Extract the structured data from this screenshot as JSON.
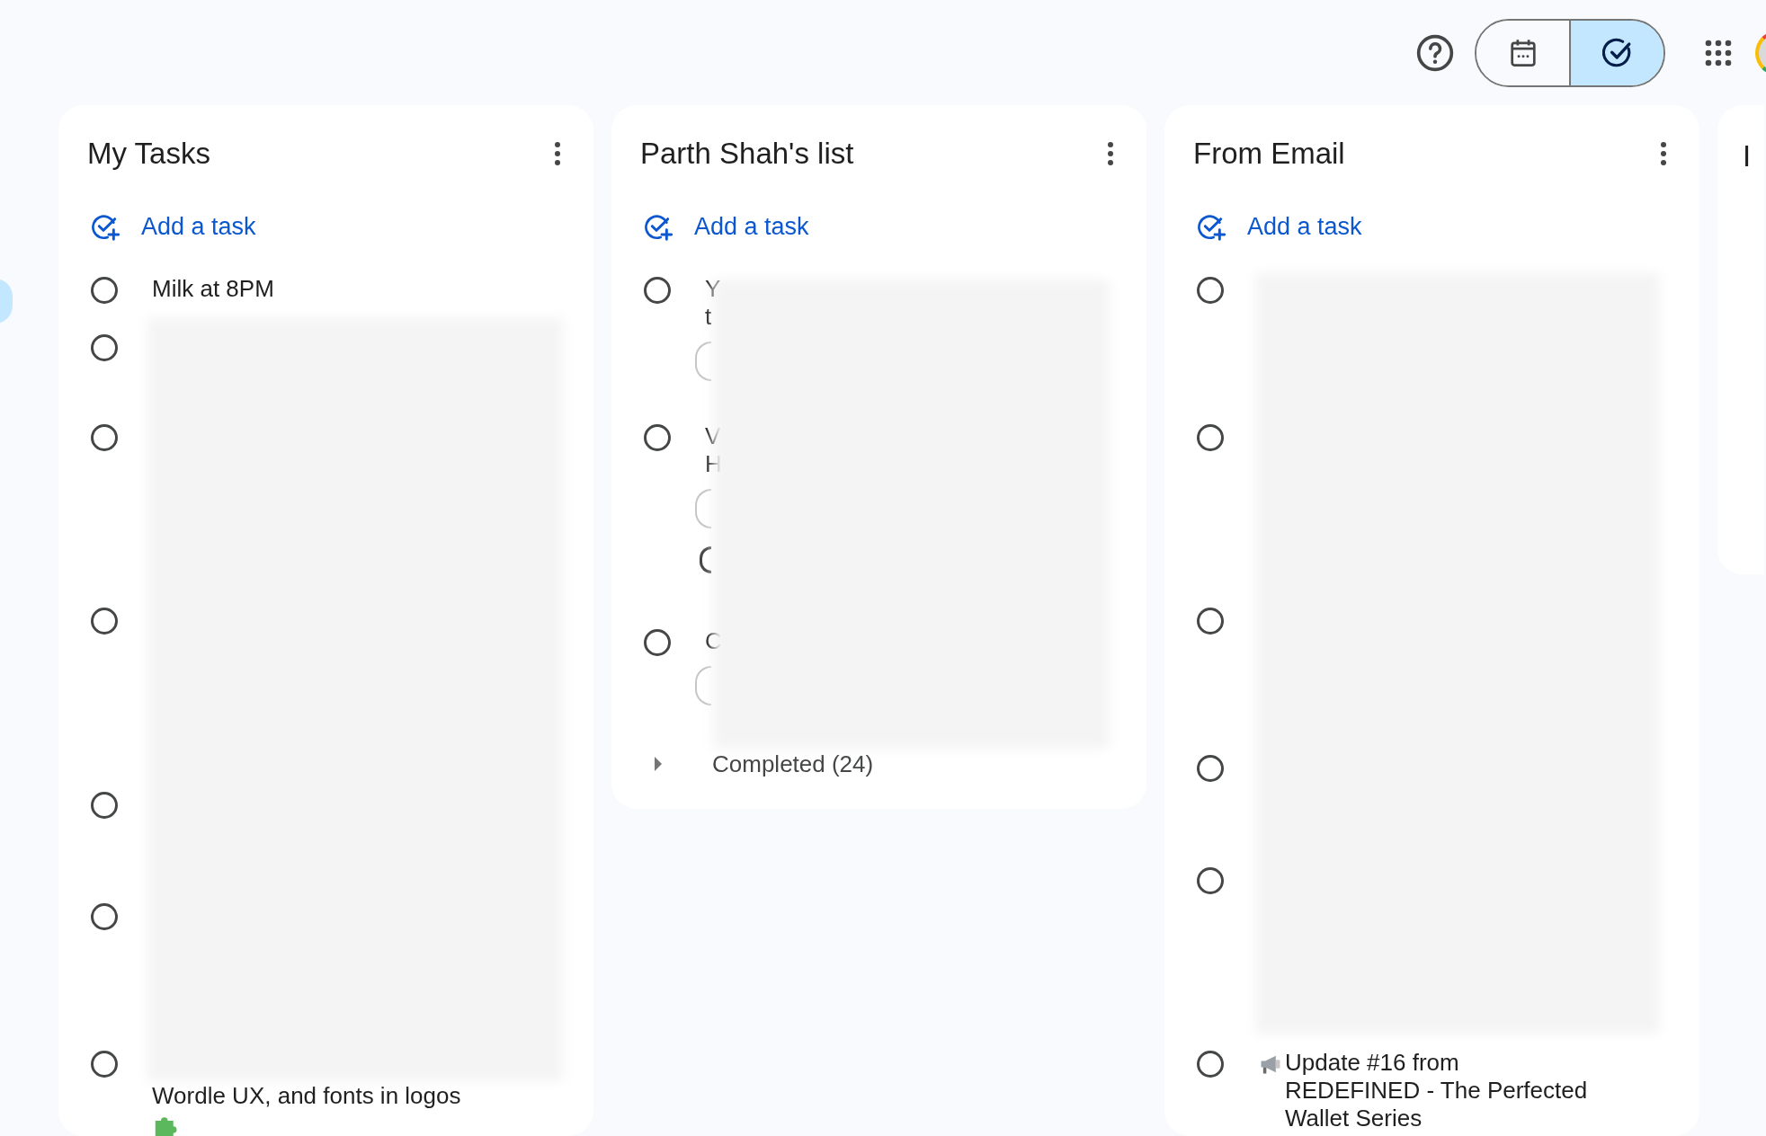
{
  "toolbar": {
    "view_toggle": [
      {
        "kind": "calendar",
        "selected": false
      },
      {
        "kind": "tasks",
        "selected": true
      }
    ]
  },
  "lists": [
    {
      "title": "My Tasks",
      "add_label": "Add a task",
      "tasks": [
        {
          "title": "Milk at 8PM",
          "completed": false
        },
        {
          "completed": false
        },
        {
          "completed": false
        },
        {
          "completed": false
        },
        {
          "completed": false
        },
        {
          "completed": false
        },
        {
          "title": "Wordle UX, and fonts in logos",
          "completed": false,
          "hidden_first_line": true,
          "kind": "puzzle"
        }
      ]
    },
    {
      "title": "Parth Shah's list",
      "add_label": "Add a task",
      "tasks": [
        {
          "title": "Y\nt",
          "completed": false,
          "subitems": [
            {
              "kind": "chip"
            }
          ]
        },
        {
          "title": "V\nH",
          "completed": false,
          "subitems": [
            {
              "kind": "chip"
            },
            {
              "kind": "checkbox",
              "checked": false
            }
          ]
        },
        {
          "title": "C",
          "completed": false,
          "subitems": [
            {
              "kind": "chip"
            }
          ]
        }
      ],
      "completed_section": {
        "label": "Completed (24)",
        "expanded": false
      }
    },
    {
      "title": "From Email",
      "add_label": "Add a task",
      "tasks": [
        {
          "completed": false
        },
        {
          "completed": false
        },
        {
          "completed": false
        },
        {
          "completed": false
        },
        {
          "completed": false
        },
        {
          "title": "Update #16 from\nREDEFINED - The Perfected\nWallet Series",
          "completed": false,
          "kind": "megaphone"
        }
      ]
    }
  ],
  "partial_list": {
    "title": "I"
  }
}
